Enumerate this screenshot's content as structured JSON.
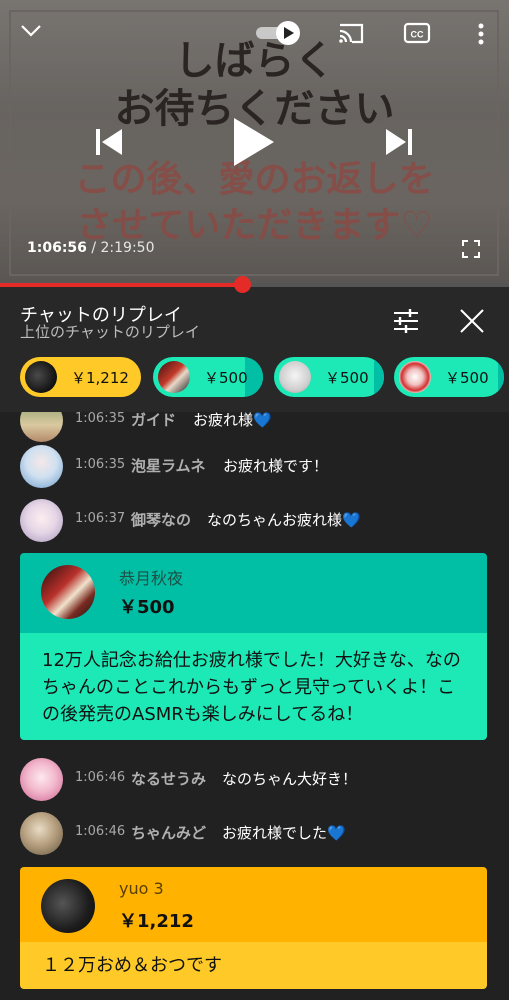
{
  "player": {
    "overlay_lines": [
      "しばらく",
      "お待ちください",
      "この後、愛のお返しを",
      "させていただきます♡"
    ],
    "current_time": "1:06:56",
    "total_time": "/ 2:19:50",
    "progress_fraction": 0.477,
    "accent_color": "#e52b28"
  },
  "chat": {
    "title": "チャットのリプレイ",
    "subtitle": "上位のチャットのリプレイ",
    "chips": [
      {
        "amount": "￥1,212",
        "color": "#ffca28"
      },
      {
        "amount": "￥500",
        "color": "#1de9b6"
      },
      {
        "amount": "￥500",
        "color": "#1de9b6"
      },
      {
        "amount": "￥500",
        "color": "#1de9b6"
      }
    ],
    "messages": [
      {
        "time": "1:06:35",
        "author": "ガイド",
        "text": "お疲れ様💙"
      },
      {
        "time": "1:06:35",
        "author": "泡星ラムネ",
        "text": "お疲れ様です！"
      },
      {
        "time": "1:06:37",
        "author": "御琴なの",
        "text": "なのちゃんお疲れ様💙"
      },
      {
        "time": "1:06:46",
        "author": "なるせうみ",
        "text": "なのちゃん大好き！"
      },
      {
        "time": "1:06:46",
        "author": "ちゃんみど",
        "text": "お疲れ様でした💙"
      }
    ],
    "superchats": [
      {
        "author": "恭月秋夜",
        "amount": "￥500",
        "message": "12万人記念お給仕お疲れ様でした！大好きな、なのちゃんのことこれからもずっと見守っていくよ！この後発売のASMRも楽しみにしてるね！",
        "head_color": "#00bfa5",
        "body_color": "#1de9b6"
      },
      {
        "author": "yuo 3",
        "amount": "￥1,212",
        "message": "１２万おめ＆おつです",
        "head_color": "#ffb300",
        "body_color": "#ffca28"
      }
    ]
  }
}
